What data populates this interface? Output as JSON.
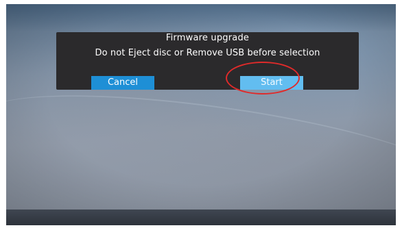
{
  "dialog": {
    "title": "Firmware upgrade",
    "message": "Do not Eject disc or Remove USB before selection",
    "buttons": {
      "cancel_label": "Cancel",
      "start_label": "Start"
    },
    "selected_button": "Start"
  },
  "colors": {
    "dialog_background": "#2b2a2c",
    "cancel_button": "#1e8fd6",
    "start_button_selected": "#62bdf0",
    "highlight_ring": "#e02a2a"
  }
}
